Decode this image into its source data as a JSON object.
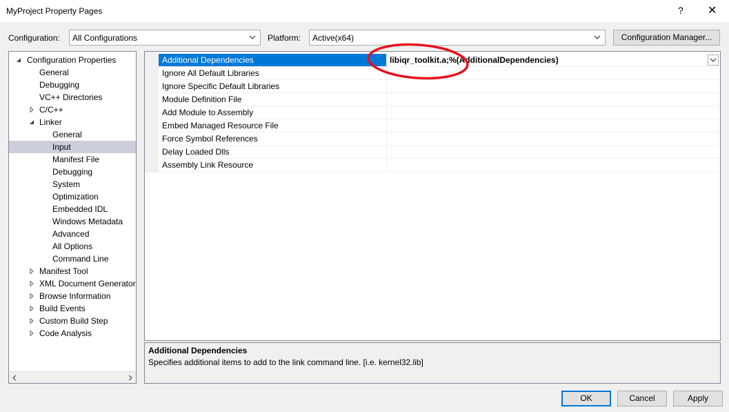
{
  "window": {
    "title": "MyProject Property Pages",
    "help_glyph": "?",
    "close_glyph": "✕"
  },
  "toolbar": {
    "configuration_label": "Configuration:",
    "configuration_value": "All Configurations",
    "platform_label": "Platform:",
    "platform_value": "Active(x64)",
    "config_manager_label": "Configuration Manager..."
  },
  "tree": {
    "items": [
      {
        "label": "Configuration Properties",
        "level": 0,
        "state": "expanded"
      },
      {
        "label": "General",
        "level": 1,
        "state": "none"
      },
      {
        "label": "Debugging",
        "level": 1,
        "state": "none"
      },
      {
        "label": "VC++ Directories",
        "level": 1,
        "state": "none"
      },
      {
        "label": "C/C++",
        "level": 1,
        "state": "collapsed"
      },
      {
        "label": "Linker",
        "level": 1,
        "state": "expanded"
      },
      {
        "label": "General",
        "level": 2,
        "state": "none"
      },
      {
        "label": "Input",
        "level": 2,
        "state": "none",
        "selected": true
      },
      {
        "label": "Manifest File",
        "level": 2,
        "state": "none"
      },
      {
        "label": "Debugging",
        "level": 2,
        "state": "none"
      },
      {
        "label": "System",
        "level": 2,
        "state": "none"
      },
      {
        "label": "Optimization",
        "level": 2,
        "state": "none"
      },
      {
        "label": "Embedded IDL",
        "level": 2,
        "state": "none"
      },
      {
        "label": "Windows Metadata",
        "level": 2,
        "state": "none"
      },
      {
        "label": "Advanced",
        "level": 2,
        "state": "none"
      },
      {
        "label": "All Options",
        "level": 2,
        "state": "none"
      },
      {
        "label": "Command Line",
        "level": 2,
        "state": "none"
      },
      {
        "label": "Manifest Tool",
        "level": 1,
        "state": "collapsed"
      },
      {
        "label": "XML Document Generator",
        "level": 1,
        "state": "collapsed"
      },
      {
        "label": "Browse Information",
        "level": 1,
        "state": "collapsed"
      },
      {
        "label": "Build Events",
        "level": 1,
        "state": "collapsed"
      },
      {
        "label": "Custom Build Step",
        "level": 1,
        "state": "collapsed"
      },
      {
        "label": "Code Analysis",
        "level": 1,
        "state": "collapsed"
      }
    ]
  },
  "grid": {
    "rows": [
      {
        "name": "Additional Dependencies",
        "value": "libiqr_toolkit.a;%(AdditionalDependencies)",
        "selected": true
      },
      {
        "name": "Ignore All Default Libraries",
        "value": ""
      },
      {
        "name": "Ignore Specific Default Libraries",
        "value": ""
      },
      {
        "name": "Module Definition File",
        "value": ""
      },
      {
        "name": "Add Module to Assembly",
        "value": ""
      },
      {
        "name": "Embed Managed Resource File",
        "value": ""
      },
      {
        "name": "Force Symbol References",
        "value": ""
      },
      {
        "name": "Delay Loaded Dlls",
        "value": ""
      },
      {
        "name": "Assembly Link Resource",
        "value": ""
      }
    ]
  },
  "description": {
    "title": "Additional Dependencies",
    "text": "Specifies additional items to add to the link command line. [i.e. kernel32.lib]"
  },
  "buttons": {
    "ok": "OK",
    "cancel": "Cancel",
    "apply": "Apply"
  },
  "colors": {
    "selection": "#0078d7",
    "tree_selection": "#cccedb",
    "annotation": "#e8101c"
  }
}
